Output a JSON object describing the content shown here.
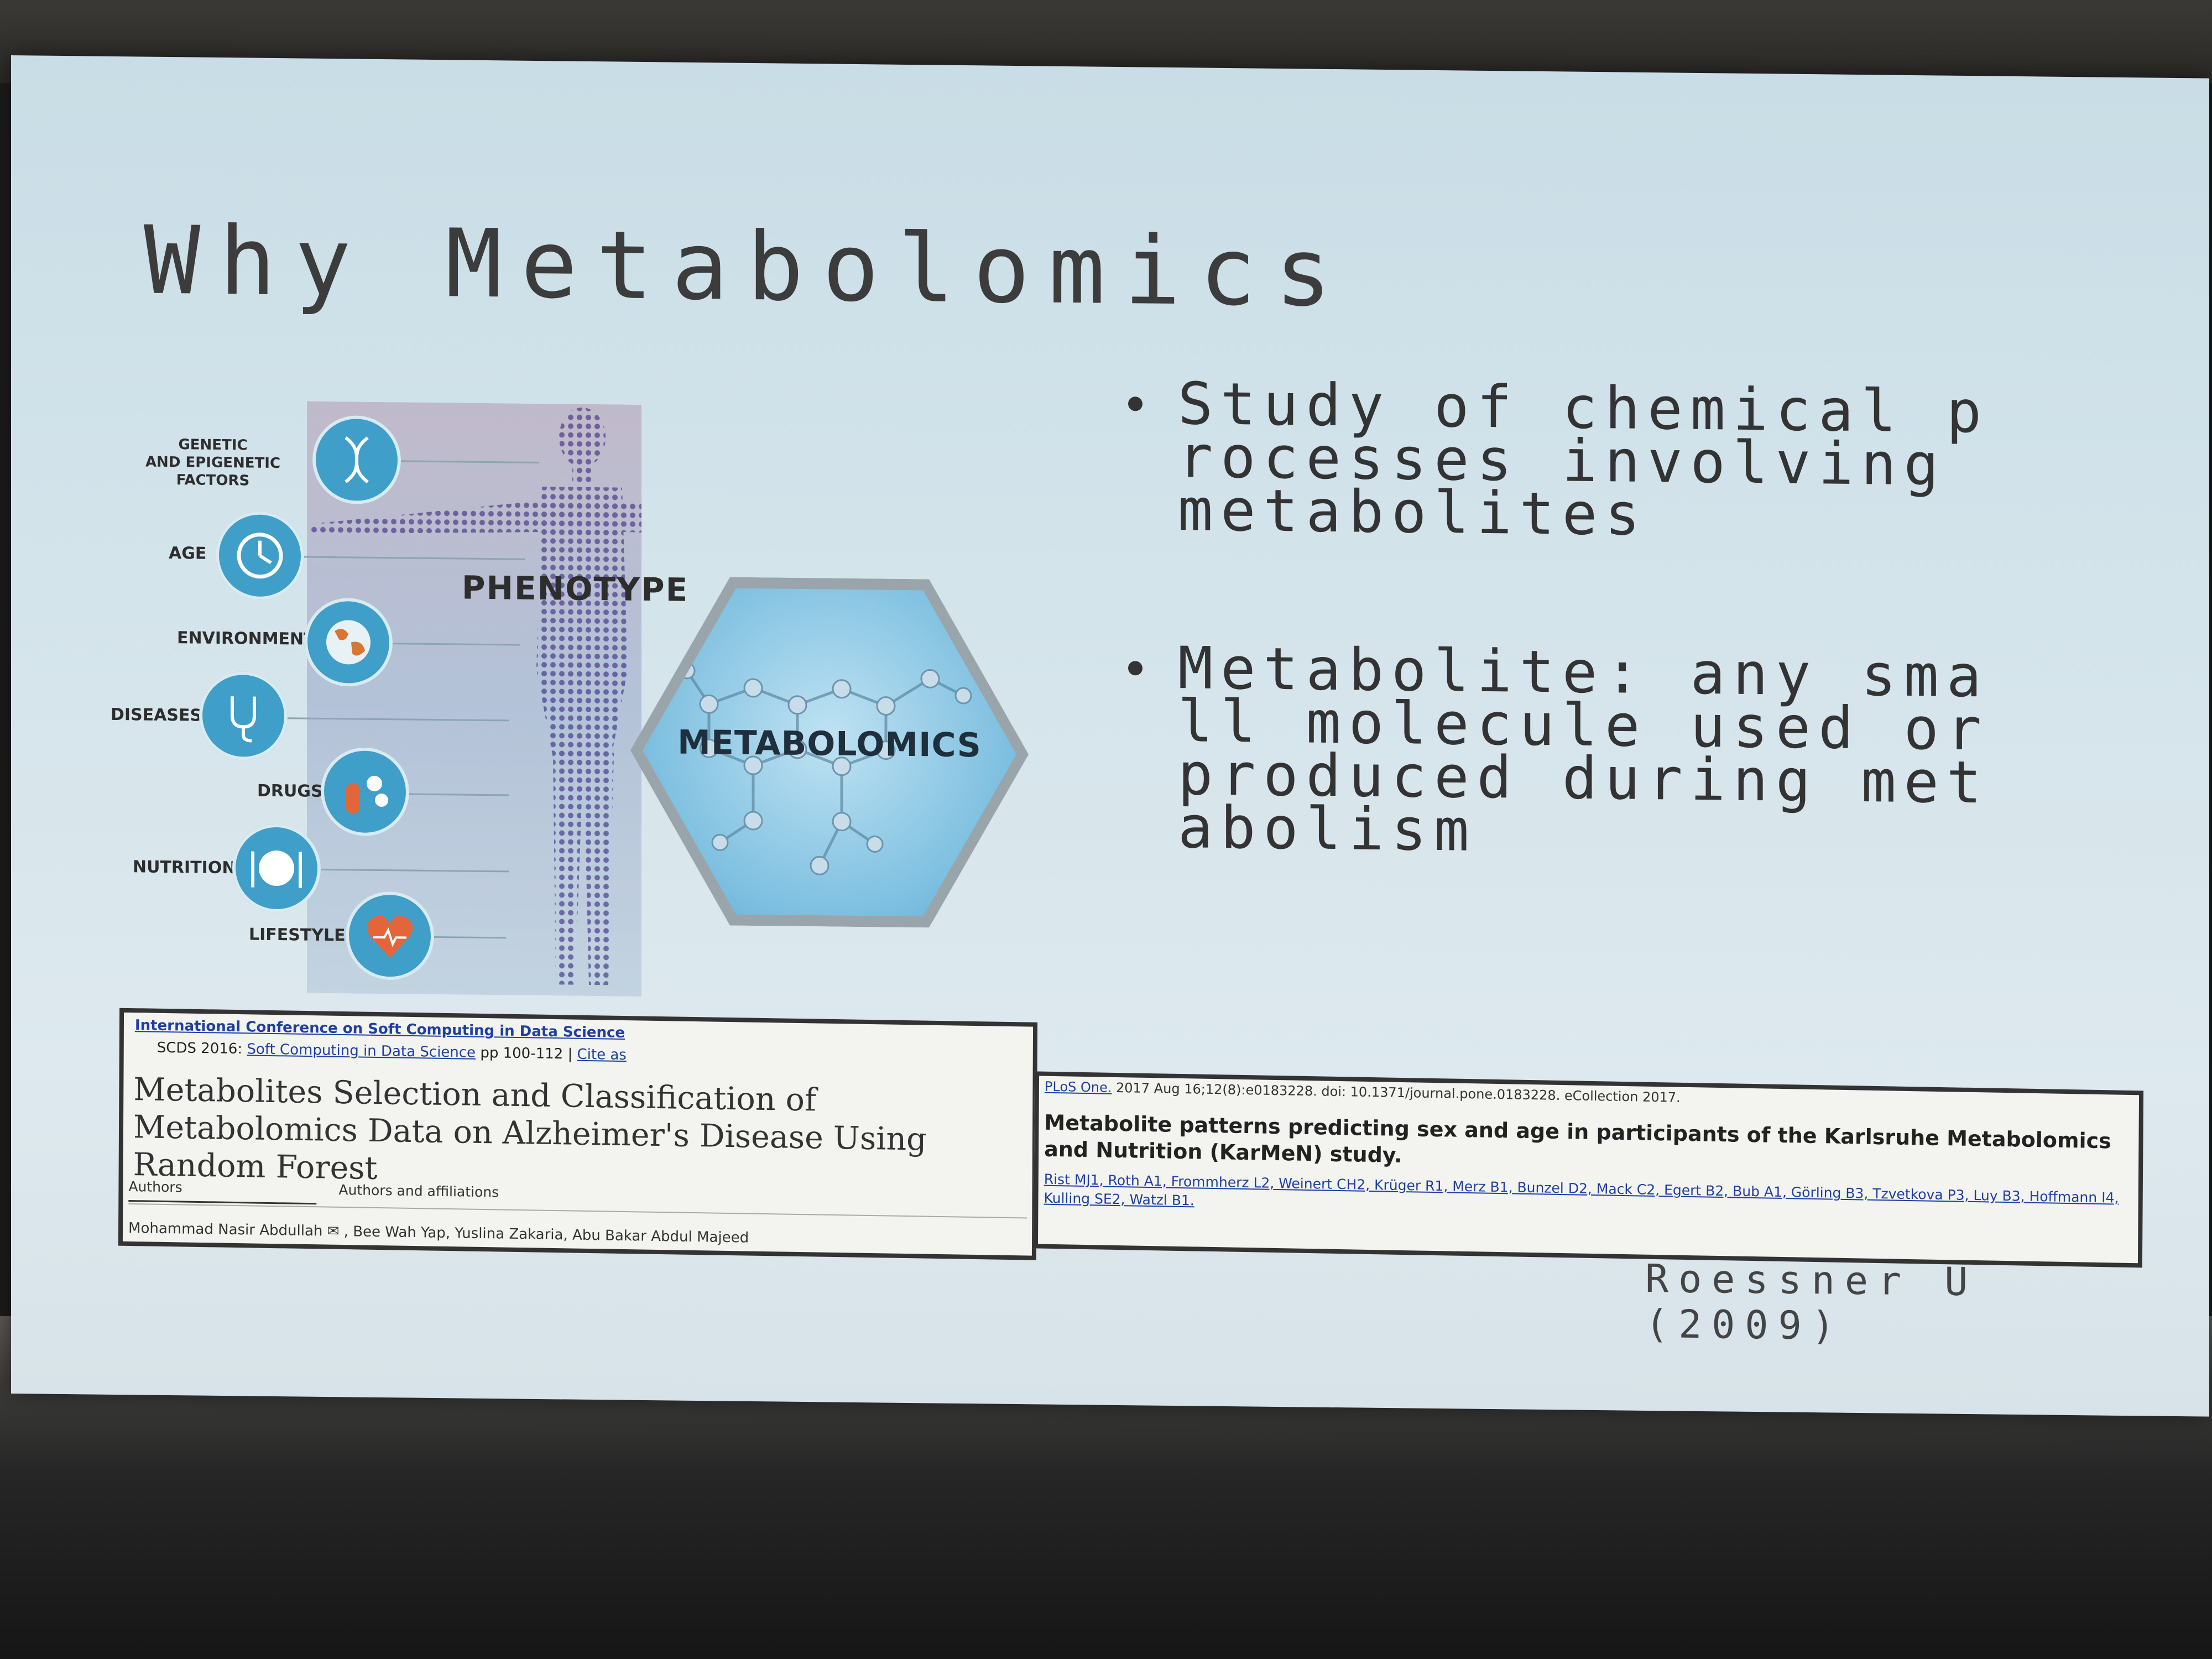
{
  "slide": {
    "title": "Why Metabolomics",
    "bullets": [
      "Study of chemical processes involving metabolites",
      "Metabolite: any small molecule used or produced during metabolism"
    ],
    "citation": {
      "author": "Roessner U",
      "year": "(2009)"
    }
  },
  "infographic": {
    "factors": [
      {
        "label": "GENETIC\nAND EPIGENETIC\nFACTORS",
        "icon": "dna-icon"
      },
      {
        "label": "AGE",
        "icon": "clock-icon"
      },
      {
        "label": "ENVIRONMENT",
        "icon": "globe-icon"
      },
      {
        "label": "DISEASES",
        "icon": "stethoscope-icon"
      },
      {
        "label": "DRUGS",
        "icon": "pills-icon"
      },
      {
        "label": "NUTRITION",
        "icon": "plate-icon"
      },
      {
        "label": "LIFESTYLE",
        "icon": "heart-icon"
      }
    ],
    "phenotype_label": "PHENOTYPE",
    "hexagon_label": "METABOLOMICS",
    "colors": {
      "circle": "#3f9fc9",
      "hexagon": "#7dbfe0",
      "heart": "#e2663a"
    }
  },
  "paper_left": {
    "conference": "International Conference on Soft Computing in Data Science",
    "series_prefix": "SCDS 2016:",
    "series_link": "Soft Computing in Data Science",
    "series_pages": "pp 100-112 |",
    "cite": "Cite as",
    "title": "Metabolites Selection and Classification of Metabolomics Data on Alzheimer's Disease Using Random Forest",
    "tab_authors": "Authors",
    "tab_affiliations": "Authors and affiliations",
    "authors": "Mohammad Nasir Abdullah ✉ , Bee Wah Yap, Yuslina Zakaria, Abu Bakar Abdul Majeed"
  },
  "paper_right": {
    "journal": "PLoS One.",
    "journal_meta": "2017 Aug 16;12(8):e0183228. doi: 10.1371/journal.pone.0183228. eCollection 2017.",
    "title": "Metabolite patterns predicting sex and age in participants of the Karlsruhe Metabolomics and Nutrition (KarMeN) study.",
    "authors": "Rist MJ1, Roth A1, Frommherz L2, Weinert CH2, Krüger R1, Merz B1, Bunzel D2, Mack C2, Egert B2, Bub A1, Görling B3, Tzvetkova P3, Luy B3, Hoffmann I4, Kulling SE2, Watzl B1."
  }
}
